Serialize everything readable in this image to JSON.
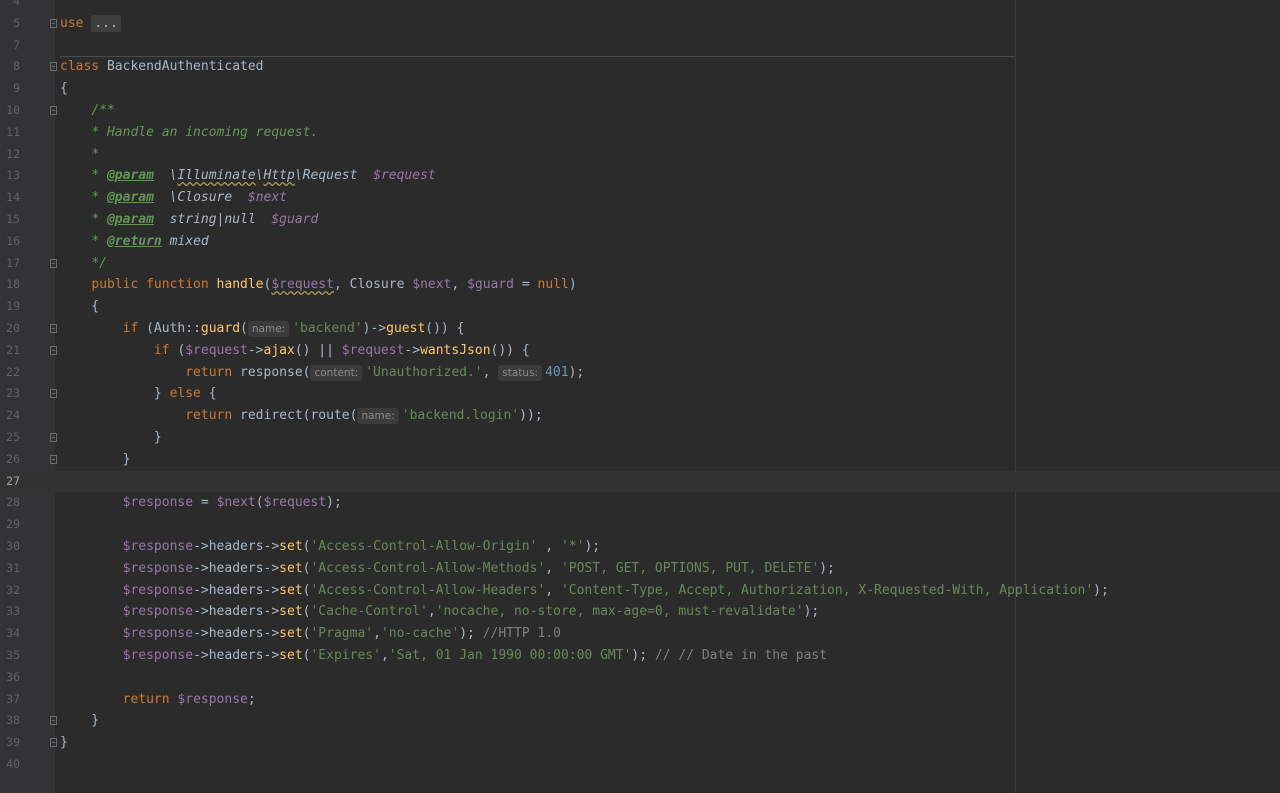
{
  "editor": {
    "current_line": 27,
    "lines": [
      {
        "n": 4,
        "html": ""
      },
      {
        "n": 5,
        "html": "<span class='kw'>use</span> <span class='collapsed'>...</span>",
        "fold": "open"
      },
      {
        "n": 7,
        "html": ""
      },
      {
        "n": 8,
        "html": "<span class='kw'>class</span> BackendAuthenticated",
        "fold": "open"
      },
      {
        "n": 9,
        "html": "{"
      },
      {
        "n": 10,
        "html": "    <span class='doc'>/**</span>",
        "fold": "open"
      },
      {
        "n": 11,
        "html": "    <span class='doc'>* Handle an incoming request.</span>"
      },
      {
        "n": 12,
        "html": "    <span class='doc'>*</span>"
      },
      {
        "n": 13,
        "html": "    <span class='doc'>* </span><span class='doctag'>@param</span>  <span class='doctype'>\\<span class='wavy'>Illuminate</span>\\<span class='wavy'>Http</span>\\Request</span>  <span class='docvar'>$request</span>"
      },
      {
        "n": 14,
        "html": "    <span class='doc'>* </span><span class='doctag'>@param</span>  <span class='doctype'>\\Closure</span>  <span class='docvar'>$next</span>"
      },
      {
        "n": 15,
        "html": "    <span class='doc'>* </span><span class='doctag'>@param</span>  <span class='doctype'>string|null</span>  <span class='docvar'>$guard</span>"
      },
      {
        "n": 16,
        "html": "    <span class='doc'>* </span><span class='doctag'>@return</span> <span class='doctype'>mixed</span>"
      },
      {
        "n": 17,
        "html": "    <span class='doc'>*/</span>",
        "fold": "open"
      },
      {
        "n": 18,
        "html": "    <span class='kw'>public function</span> <span class='fn'>handle</span>(<span class='var wavy'>$request</span>, Closure <span class='var'>$next</span>, <span class='var'>$guard</span> = <span class='kw'>null</span>)"
      },
      {
        "n": 19,
        "html": "    {"
      },
      {
        "n": 20,
        "html": "        <span class='kw'>if</span> (Auth::<span class='fn'>guard</span>(<span class='hint'>name:</span><span class='str'>'backend'</span>)-><span class='fn'>guest</span>()) {",
        "fold": "open"
      },
      {
        "n": 21,
        "html": "            <span class='kw'>if</span> (<span class='var'>$request</span>-><span class='fn'>ajax</span>() || <span class='var'>$request</span>-><span class='fn'>wantsJson</span>()) {",
        "fold": "open"
      },
      {
        "n": 22,
        "html": "                <span class='kw'>return</span> response(<span class='hint'>content:</span><span class='str'>'Unauthorized.'</span>, <span class='hint'>status:</span><span class='num'>401</span>);"
      },
      {
        "n": 23,
        "html": "            } <span class='kw'>else</span> {",
        "fold": "open"
      },
      {
        "n": 24,
        "html": "                <span class='kw'>return</span> redirect(route(<span class='hint'>name:</span><span class='str'>'backend.login'</span>));"
      },
      {
        "n": 25,
        "html": "            }",
        "fold": "open"
      },
      {
        "n": 26,
        "html": "        }",
        "fold": "open"
      },
      {
        "n": 27,
        "html": ""
      },
      {
        "n": 28,
        "html": "        <span class='var'>$response</span> = <span class='var'>$next</span>(<span class='var'>$request</span>);"
      },
      {
        "n": 29,
        "html": ""
      },
      {
        "n": 30,
        "html": "        <span class='var'>$response</span>->headers-><span class='fn'>set</span>(<span class='str'>'Access-Control-Allow-Origin'</span> , <span class='str'>'*'</span>);"
      },
      {
        "n": 31,
        "html": "        <span class='var'>$response</span>->headers-><span class='fn'>set</span>(<span class='str'>'Access-Control-Allow-Methods'</span>, <span class='str'>'POST, GET, OPTIONS, PUT, DELETE'</span>);"
      },
      {
        "n": 32,
        "html": "        <span class='var'>$response</span>->headers-><span class='fn'>set</span>(<span class='str'>'Access-Control-Allow-Headers'</span>, <span class='str'>'Content-Type, Accept, Authorization, X-Requested-With, Application'</span>);"
      },
      {
        "n": 33,
        "html": "        <span class='var'>$response</span>->headers-><span class='fn'>set</span>(<span class='str'>'Cache-Control'</span>,<span class='str'>'nocache, no-store, max-age=0, must-revalidate'</span>);"
      },
      {
        "n": 34,
        "html": "        <span class='var'>$response</span>->headers-><span class='fn'>set</span>(<span class='str'>'Pragma'</span>,<span class='str'>'no-cache'</span>); <span class='comment'>//HTTP 1.0</span>"
      },
      {
        "n": 35,
        "html": "        <span class='var'>$response</span>->headers-><span class='fn'>set</span>(<span class='str'>'Expires'</span>,<span class='str'>'Sat, 01 Jan 1990 00:00:00 GMT'</span>); <span class='comment'>// // Date in the past</span>"
      },
      {
        "n": 36,
        "html": ""
      },
      {
        "n": 37,
        "html": "        <span class='kw'>return</span> <span class='var'>$response</span>;"
      },
      {
        "n": 38,
        "html": "    }",
        "fold": "open"
      },
      {
        "n": 39,
        "html": "}",
        "fold": "open"
      },
      {
        "n": 40,
        "html": ""
      }
    ]
  }
}
